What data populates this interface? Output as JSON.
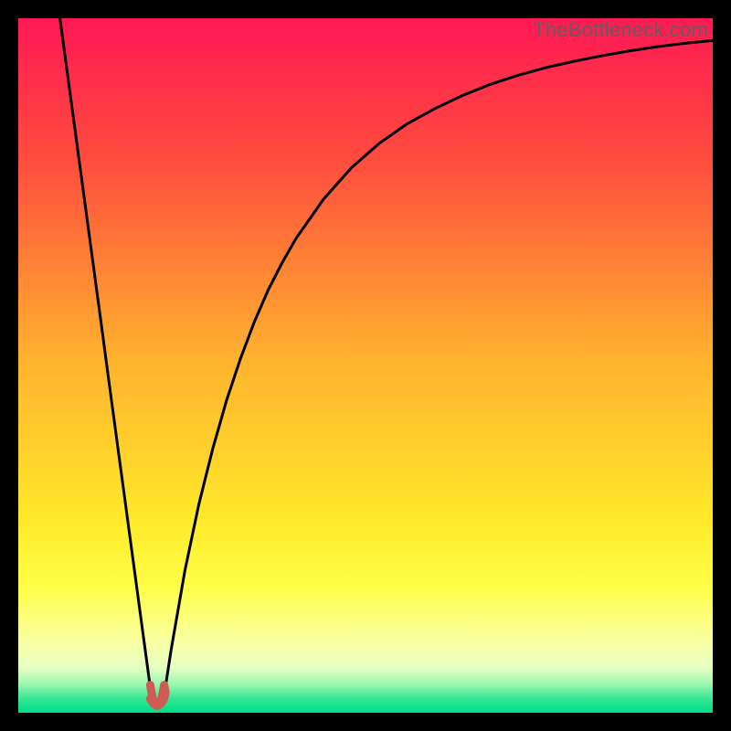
{
  "watermark": {
    "text": "TheBottleneck.com"
  },
  "frame": {
    "border_color": "#000000",
    "inner_size_px": 760
  },
  "chart_data": {
    "type": "line",
    "title": "",
    "xlabel": "",
    "ylabel": "",
    "xlim": [
      0,
      100
    ],
    "ylim": [
      0,
      100
    ],
    "x": [
      0,
      1,
      2,
      3,
      4,
      5,
      6,
      7,
      8,
      9,
      10,
      11,
      12,
      13,
      14,
      15,
      16,
      17,
      18,
      19,
      20,
      21,
      22,
      24,
      26,
      28,
      30,
      32,
      34,
      36,
      38,
      40,
      44,
      48,
      52,
      56,
      60,
      64,
      68,
      72,
      76,
      80,
      84,
      88,
      92,
      96,
      100
    ],
    "series": [
      {
        "name": "left-branch",
        "x": [
          6,
          7,
          8,
          9,
          10,
          11,
          12,
          13,
          14,
          15,
          16,
          17,
          18,
          19,
          19.5
        ],
        "values": [
          100,
          92.6,
          85.2,
          77.8,
          70.4,
          63.0,
          55.6,
          48.1,
          40.7,
          33.3,
          25.9,
          18.5,
          11.1,
          3.7,
          1.0
        ]
      },
      {
        "name": "cusp-pink",
        "x": [
          19.0,
          19.3,
          19.6,
          20.0,
          20.4,
          20.7,
          21.0,
          21.2,
          21.0,
          20.7,
          20.4,
          20.0,
          19.6,
          19.3,
          19.0
        ],
        "values": [
          4.0,
          2.3,
          1.3,
          1.0,
          1.3,
          2.3,
          4.0,
          3.0,
          2.0,
          1.5,
          1.2,
          1.0,
          1.2,
          1.5,
          2.0
        ]
      },
      {
        "name": "right-branch",
        "x": [
          20.5,
          21,
          22,
          24,
          26,
          28,
          30,
          32,
          34,
          36,
          38,
          40,
          44,
          48,
          52,
          56,
          60,
          64,
          68,
          72,
          76,
          80,
          84,
          88,
          92,
          96,
          100
        ],
        "values": [
          1.0,
          2.5,
          9.0,
          20.5,
          30.0,
          38.0,
          45.0,
          51.0,
          56.3,
          60.9,
          64.8,
          68.3,
          74.0,
          78.5,
          82.0,
          84.8,
          87.0,
          88.9,
          90.5,
          91.8,
          92.9,
          93.8,
          94.6,
          95.3,
          95.9,
          96.4,
          96.8
        ]
      }
    ],
    "colors": {
      "curve_main": "#000000",
      "cusp": "#cf5b55",
      "curve_stroke_width_px": 3
    },
    "background_gradient": {
      "type": "vertical",
      "stops": [
        {
          "pct": 0,
          "color": "#ff1954"
        },
        {
          "pct": 20,
          "color": "#ff4b3e"
        },
        {
          "pct": 50,
          "color": "#ffb52e"
        },
        {
          "pct": 72,
          "color": "#ffe82a"
        },
        {
          "pct": 82,
          "color": "#feff47"
        },
        {
          "pct": 90,
          "color": "#f9ffa5"
        },
        {
          "pct": 93.5,
          "color": "#e6ffc2"
        },
        {
          "pct": 96,
          "color": "#97f7af"
        },
        {
          "pct": 98,
          "color": "#33e693"
        },
        {
          "pct": 100,
          "color": "#00dd88"
        }
      ]
    }
  }
}
